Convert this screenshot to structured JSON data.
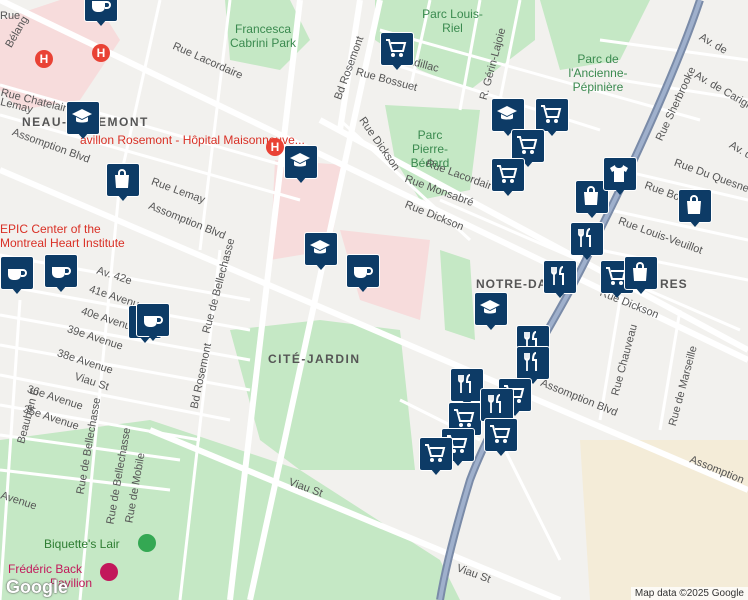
{
  "labels": {
    "francesca": "Francesca Cabrini Park",
    "parc_louis_riel": "Parc Louis-Riel",
    "parc_ancienne": "Parc de l'Ancienne-Pépinière",
    "parc_bedard": "Parc Pierre-Bédard",
    "hood_rosemont": "NEAU-ROSEMONT",
    "pavillon": "avillon Rosemont - Hôpital Maisonneuve...",
    "epic": "EPIC Center of the Montreal Heart Institute",
    "cite_jardin": "CITÉ-JARDIN",
    "notre_dame": "NOTRE-DA",
    "notre_dame_end": "RES",
    "biquette": "Biquette's Lair",
    "frederic": "Frédéric Back",
    "frederic2": "Pavilion"
  },
  "streets": [
    "Rue Lacordaire",
    "Bd Rosemont",
    "Rue Bossuet",
    "Cadillac",
    "R. Gérin-Lajoie",
    "Rue Chatelain",
    "Lemay",
    "Assomption Blvd",
    "Rue Lemay",
    "Rue Dickson",
    "Rue Lacordaire",
    "Rue Monsabré",
    "Rue Dickson",
    "Rue Sherbrooke",
    "Av. de",
    "Av. de Carignan",
    "Rue Du Quesne",
    "Av. de",
    "Rue Bossuet",
    "Rue Louis-Veuillot",
    "Assomption Blvd",
    "Av. 42e",
    "41e Avenue",
    "40e Avenue",
    "39e Avenue",
    "38e Avenue",
    "36e Avenue",
    "35e Avenue",
    "Viau St",
    "Rue de Bellechasse",
    "Bd Rosemont",
    "Rue Dickson",
    "Assomption Blvd",
    "Rue Chauveau",
    "Rue de Marseille",
    "Assomption",
    "Viau St",
    "Viau St",
    "Rue de Bellechasse",
    "Rue de Mobile",
    "Beaubien E",
    "Rue de Bellechasse",
    "Avenue",
    "Rue",
    "Bélang"
  ],
  "markers": [
    {
      "type": "coffee"
    },
    {
      "type": "school"
    },
    {
      "type": "cart"
    },
    {
      "type": "school"
    },
    {
      "type": "cart"
    },
    {
      "type": "bag"
    },
    {
      "type": "school"
    },
    {
      "type": "coffee"
    },
    {
      "type": "school"
    },
    {
      "type": "coffee"
    },
    {
      "type": "coffee"
    },
    {
      "type": "bag"
    },
    {
      "type": "cart"
    },
    {
      "type": "cart"
    },
    {
      "type": "bag"
    },
    {
      "type": "shirt"
    },
    {
      "type": "bag"
    },
    {
      "type": "fork"
    },
    {
      "type": "fork"
    },
    {
      "type": "cart"
    },
    {
      "type": "bag"
    },
    {
      "type": "school"
    },
    {
      "type": "fork"
    },
    {
      "type": "fork"
    },
    {
      "type": "fork"
    },
    {
      "type": "cart"
    },
    {
      "type": "cart"
    },
    {
      "type": "fork"
    },
    {
      "type": "cart"
    },
    {
      "type": "cart"
    },
    {
      "type": "cart"
    },
    {
      "type": "coffee"
    }
  ],
  "hospital_letter": "H",
  "attribution": "Map data ©2025 Google",
  "logo": "Google",
  "colors": {
    "marker": "#0d3b66",
    "park": "#c5e8c5",
    "highway": "#7a8ba8",
    "hospital": "#e94235"
  }
}
